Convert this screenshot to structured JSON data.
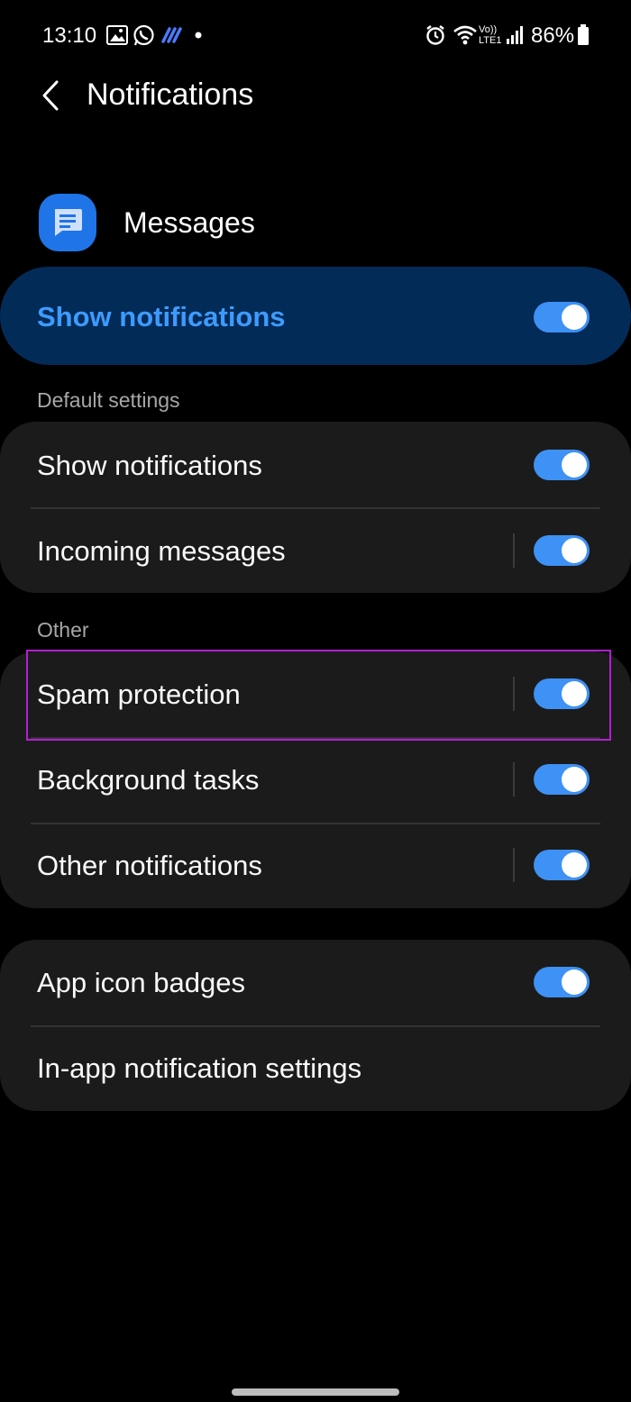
{
  "status_bar": {
    "time": "13:10",
    "battery_percent": "86%",
    "network": "LTE1",
    "volte": "Vo))",
    "icons": [
      "gallery-icon",
      "whatsapp-icon",
      "app-logo-icon",
      "dot-icon",
      "alarm-icon",
      "wifi-icon",
      "signal-icon",
      "battery-icon"
    ]
  },
  "header": {
    "title": "Notifications"
  },
  "app": {
    "name": "Messages",
    "icon": "messages-icon",
    "icon_color": "#1f74e8"
  },
  "master": {
    "label": "Show notifications",
    "enabled": true
  },
  "sections": {
    "default": {
      "title": "Default settings",
      "items": [
        {
          "label": "Show notifications",
          "enabled": true
        },
        {
          "label": "Incoming messages",
          "enabled": true
        }
      ]
    },
    "other": {
      "title": "Other",
      "items": [
        {
          "label": "Spam protection",
          "enabled": true
        },
        {
          "label": "Background tasks",
          "enabled": true
        },
        {
          "label": "Other notifications",
          "enabled": true
        }
      ]
    },
    "misc": {
      "items": [
        {
          "label": "App icon badges",
          "enabled": true
        },
        {
          "label": "In-app notification settings"
        }
      ]
    }
  },
  "colors": {
    "accent": "#3e91f5",
    "master_bg": "#032b58",
    "master_text": "#3d9bff",
    "card_bg": "#1b1b1b",
    "highlight": "#b51ed3"
  }
}
